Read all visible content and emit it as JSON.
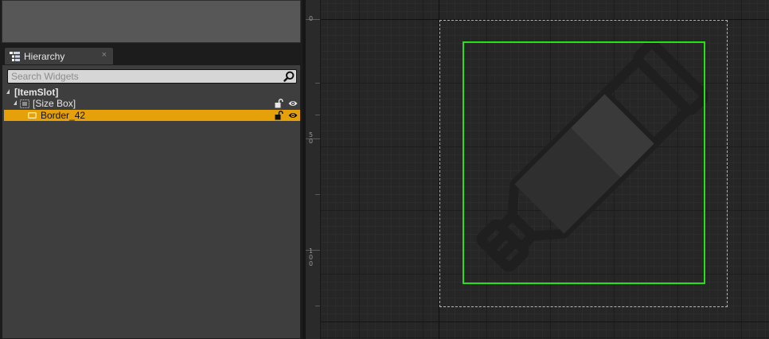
{
  "hierarchy": {
    "tab_label": "Hierarchy",
    "tab_close": "×",
    "search_placeholder": "Search Widgets",
    "tree": [
      {
        "label": "[ItemSlot]",
        "icons": []
      },
      {
        "label": "[Size Box]",
        "icons": [
          "lock-icon",
          "eye-icon"
        ]
      },
      {
        "label": "Border_42",
        "icons": [
          "lock-icon",
          "eye-icon"
        ],
        "selected": true
      }
    ]
  },
  "designer": {
    "ruler_labels": [
      "0",
      "5\n0",
      "1\n0\n0"
    ]
  },
  "colors": {
    "selection": "#e6a10a",
    "selected_widget_outline": "#27e01a",
    "panel_bg": "#3e3e3e",
    "canvas_bg": "#262626"
  }
}
